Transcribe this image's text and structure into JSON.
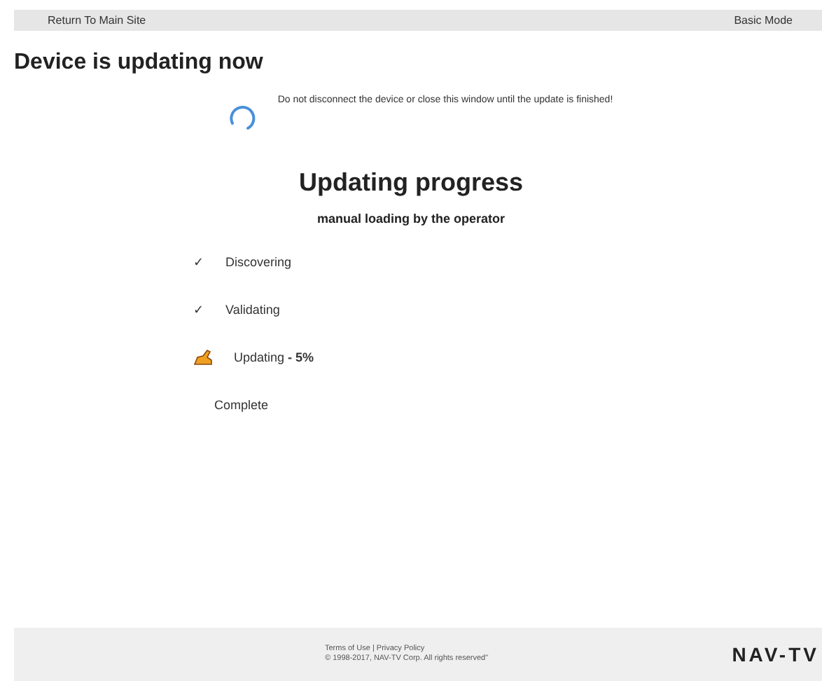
{
  "top_bar": {
    "return_link": "Return To Main Site",
    "mode_link": "Basic Mode"
  },
  "title": "Device is updating now",
  "notice": "Do not disconnect the device or close this window until the update is finished!",
  "progress": {
    "title": "Updating progress",
    "subtitle": "manual loading by the operator",
    "steps": [
      {
        "kind": "done",
        "icon": "✓",
        "label": "Discovering"
      },
      {
        "kind": "done",
        "icon": "✓",
        "label": "Validating"
      },
      {
        "kind": "active",
        "label": "Updating",
        "percent": "- 5%"
      },
      {
        "kind": "pending",
        "label": "Complete"
      }
    ]
  },
  "footer": {
    "links": [
      {
        "label": "Terms of Use"
      },
      {
        "label": "Privacy Policy"
      }
    ],
    "separator": "|",
    "copyright": "© 1998-2017, NAV-TV Corp. All rights reserved\"",
    "logo": "NAV-TV"
  }
}
